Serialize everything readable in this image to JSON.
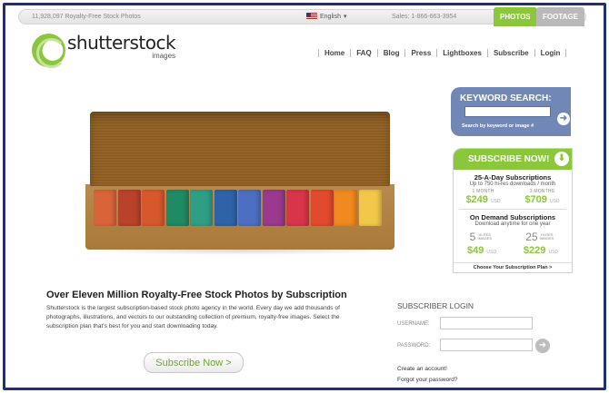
{
  "topbar": {
    "photo_count": "11,928,097 Royalty-Free Stock Photos",
    "language": "English",
    "sales": "Sales: 1-866-663-3954",
    "tab_photos": "PHOTOS",
    "tab_footage": "FOOTAGE"
  },
  "logo": {
    "name": "shutterstock",
    "sub": "images"
  },
  "nav": [
    "Home",
    "FAQ",
    "Blog",
    "Press",
    "Lightboxes",
    "Subscribe",
    "Login"
  ],
  "keyword_search": {
    "title": "KEYWORD SEARCH:",
    "hint": "Search by keyword or image #",
    "go_icon": "arrow-right-icon"
  },
  "subscribe_panel": {
    "title": "SUBSCRIBE NOW!",
    "daily": {
      "title": "25-A-Day Subscriptions",
      "desc": "Up to 750 hi-res downloads / month",
      "options": [
        {
          "label": "1 MONTH",
          "price": "$249",
          "currency": "USD"
        },
        {
          "label": "3 MONTHS",
          "price": "$709",
          "currency": "USD"
        }
      ]
    },
    "on_demand": {
      "title": "On Demand Subscriptions",
      "desc": "Download anytime for one year",
      "options": [
        {
          "qty": "5",
          "unit": "HI-RES IMAGES",
          "price": "$49",
          "currency": "USD"
        },
        {
          "qty": "25",
          "unit": "HI-RES IMAGES",
          "price": "$229",
          "currency": "USD"
        }
      ]
    },
    "footer": "Choose Your Subscription Plan >"
  },
  "hero": {
    "pastel_colors": [
      "#d9643a",
      "#b9422a",
      "#d8582e",
      "#1f8a63",
      "#2f9e86",
      "#2e63a8",
      "#4c6fc1",
      "#9a3a8e",
      "#d8344a",
      "#e14a2c",
      "#f08a1f",
      "#f3c84a"
    ]
  },
  "main": {
    "headline": "Over Eleven Million Royalty-Free Stock Photos by Subscription",
    "blurb": "Shutterstock is the largest subscription-based stock photo agency in the world. Every day we add thousands of photographs, illustrations, and vectors to our outstanding collection of premium, royalty-free images. Select the subscription plan that's best for you and start downloading today.",
    "subscribe_button": "Subscribe Now >"
  },
  "login": {
    "title": "SUBSCRIBER LOGIN",
    "username_label": "USERNAME:",
    "password_label": "PASSWORD:",
    "create_account": "Create an account!",
    "forgot_password": "Forgot your password?"
  },
  "colors": {
    "frame": "#1f2f7a",
    "brand_green": "#8bc73a",
    "search_blue": "#7187b5"
  }
}
